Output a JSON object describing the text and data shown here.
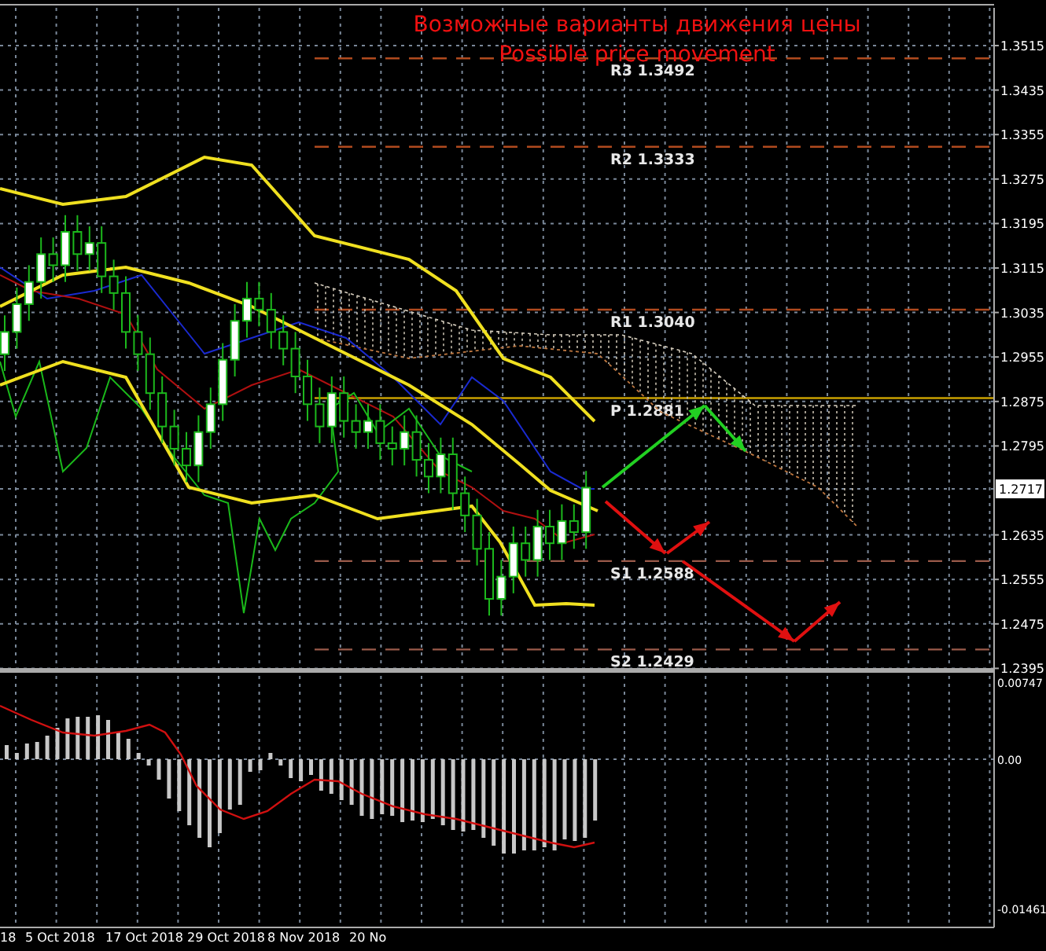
{
  "chart": {
    "title": "Возможные варианты движения цены",
    "subtitle": "Possible price movement",
    "price_axis": [
      "1.3515",
      "1.3435",
      "1.3355",
      "1.3275",
      "1.3195",
      "1.3115",
      "1.3035",
      "1.2955",
      "1.2875",
      "1.2795",
      "1.2635",
      "1.2555",
      "1.2475",
      "1.2395"
    ],
    "current_price": "1.2717",
    "pivot_levels": [
      {
        "kind": "resistance",
        "label": "R3 1.3492"
      },
      {
        "kind": "resistance",
        "label": "R2 1.3333"
      },
      {
        "kind": "resistance",
        "label": "R1 1.3040"
      },
      {
        "kind": "pivot",
        "label": "P 1.2881"
      },
      {
        "kind": "support",
        "label": "S1 1.2588"
      },
      {
        "kind": "support",
        "label": "S2 1.2429"
      }
    ],
    "indicator_axis": [
      "0.00747",
      "0.00",
      "-0.01461"
    ],
    "date_axis": [
      "18",
      "5 Oct 2018",
      "17 Oct 2018",
      "29 Oct 2018",
      "8 Nov 2018",
      "20 No"
    ]
  }
}
